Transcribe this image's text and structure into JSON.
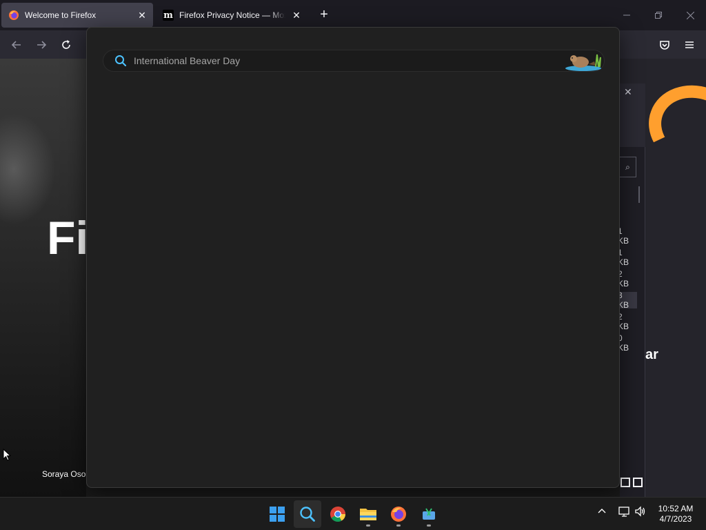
{
  "browser": {
    "tabs": [
      {
        "title": "Welcome to Firefox",
        "active": true
      },
      {
        "title": "Firefox Privacy Notice — Mozilla",
        "active": false,
        "favicon_letter": "m"
      }
    ],
    "new_tab_label": "+"
  },
  "page": {
    "hero_text": "Firefox he",
    "photo_credit": "Soraya Osorio",
    "side_text": "ar",
    "file_sizes": [
      "1 KB",
      "1 KB",
      "2 KB",
      "3 KB",
      "2 KB",
      "0 KB"
    ]
  },
  "search": {
    "placeholder": "International Beaver Day",
    "value": ""
  },
  "taskbar": {
    "apps": [
      "start",
      "search",
      "chrome",
      "file-explorer",
      "firefox",
      "snipping-tool"
    ],
    "time": "10:52 AM",
    "date": "4/7/2023"
  },
  "colors": {
    "accent_orange": "#ff9f2e",
    "flyout_bg": "#202020",
    "tab_active": "#42414d"
  }
}
